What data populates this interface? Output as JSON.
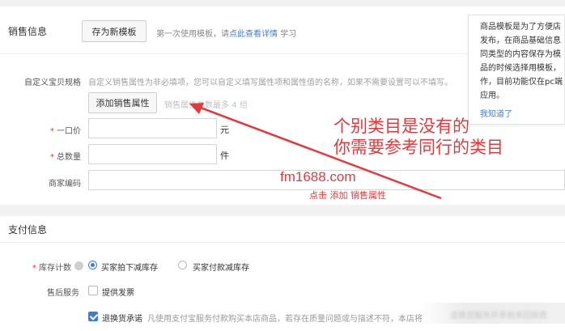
{
  "sales": {
    "title": "销售信息",
    "save_template_button": "存为新模板",
    "hint_prefix": "第一次使用模板，请",
    "hint_link": "点此查看详情",
    "hint_suffix": "学习",
    "custom_spec_label": "自定义宝贝规格",
    "custom_spec_desc": "自定义销售属性为非必填项，您可以自定义填写属性项和属性值的名称，如果不需要设置可以不填写。",
    "add_attr_button": "添加销售属性",
    "attr_limit_note": "销售属性总数最多 4 组",
    "price_label": "一口价",
    "price_unit": "元",
    "qty_label": "总数量",
    "qty_unit": "件",
    "merchant_code_label": "商家编码"
  },
  "tooltip": {
    "lines": [
      "商品模板是为了方便店",
      "发布，在商品基础信息",
      "同类型的内容保存为模",
      "品的时候选择用模板，",
      "作，目前功能仅在pc端",
      "应用。"
    ],
    "link": "我知道了"
  },
  "payment": {
    "title": "支付信息",
    "stock_label": "库存计数",
    "stock_options": [
      "买家拍下减库存",
      "买家付款减库存"
    ],
    "after_sale_label": "售后服务",
    "invoice_label": "提供发票",
    "return_label": "退换货承诺",
    "return_desc": "凡使用支付宝服务付款购买本店商品，若存在质量问题或与描述不符，本店将",
    "return_desc_tail": "退换货服务并承担来回邮费"
  },
  "annotations": {
    "line1": "个别类目是没有的",
    "line2": "你需要参考同行的类目",
    "watermark": "fm1688.com",
    "click_hint": "点击 添加 销售属性"
  },
  "colors": {
    "annotation_red": "#e4393c",
    "link_blue": "#3d7ed1"
  }
}
